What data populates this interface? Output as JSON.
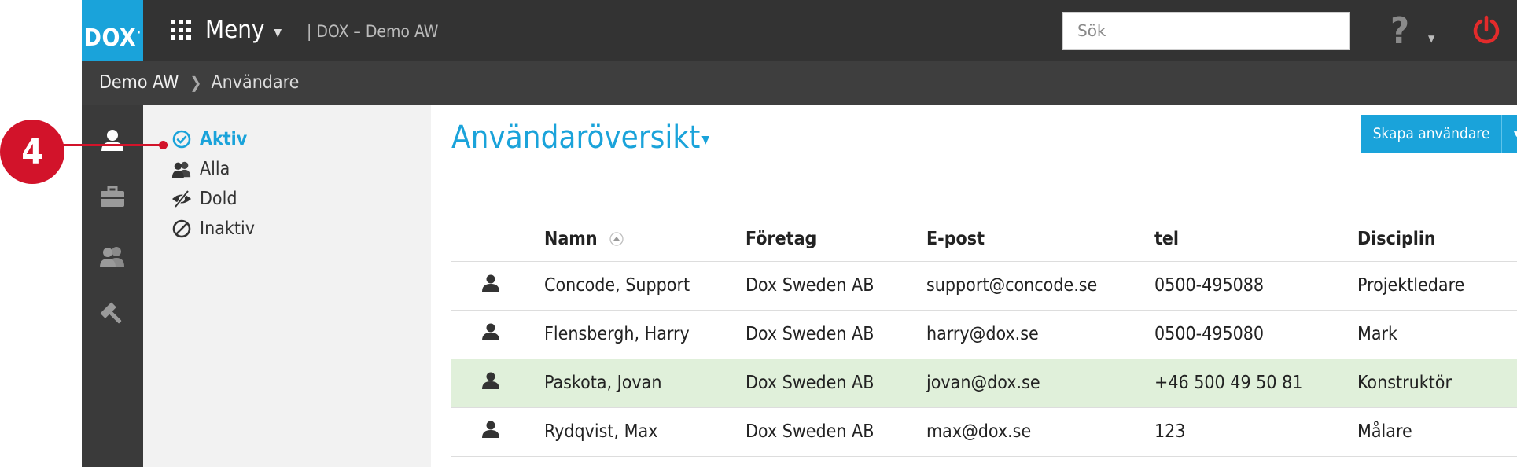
{
  "callout": {
    "number": "4"
  },
  "topbar": {
    "logo": "DOX",
    "menu_label": "Meny",
    "app_path": "| DOX – Demo AW",
    "search_placeholder": "Sök",
    "help_label": "?"
  },
  "breadcrumb": {
    "root": "Demo AW",
    "current": "Användare"
  },
  "rail": {
    "items": [
      {
        "name": "user",
        "icon": "user-icon",
        "active": true
      },
      {
        "name": "company",
        "icon": "briefcase-icon",
        "active": false
      },
      {
        "name": "groups",
        "icon": "users-icon",
        "active": false
      },
      {
        "name": "admin",
        "icon": "hammer-icon",
        "active": false
      }
    ]
  },
  "filters": {
    "items": [
      {
        "label": "Aktiv",
        "icon": "check-circle-icon",
        "active": true
      },
      {
        "label": "Alla",
        "icon": "users-icon",
        "active": false
      },
      {
        "label": "Dold",
        "icon": "eye-slash-icon",
        "active": false
      },
      {
        "label": "Inaktiv",
        "icon": "ban-icon",
        "active": false
      }
    ]
  },
  "main": {
    "title": "Användaröversikt",
    "create_button": "Skapa användare",
    "table": {
      "headers": {
        "name": "Namn",
        "company": "Företag",
        "email": "E-post",
        "tel": "tel",
        "discipline": "Disciplin"
      },
      "rows": [
        {
          "name": "Concode, Support",
          "company": "Dox Sweden AB",
          "email": "support@concode.se",
          "tel": "0500-495088",
          "discipline": "Projektledare",
          "selected": false
        },
        {
          "name": "Flensbergh, Harry",
          "company": "Dox Sweden AB",
          "email": "harry@dox.se",
          "tel": "0500-495080",
          "discipline": "Mark",
          "selected": false
        },
        {
          "name": "Paskota, Jovan",
          "company": "Dox Sweden AB",
          "email": "jovan@dox.se",
          "tel": "+46 500 49 50 81",
          "discipline": "Konstruktör",
          "selected": true
        },
        {
          "name": "Rydqvist, Max",
          "company": "Dox Sweden AB",
          "email": "max@dox.se",
          "tel": "123",
          "discipline": "Målare",
          "selected": false
        }
      ]
    }
  },
  "colors": {
    "accent": "#1aa3da",
    "callout": "#d2132a",
    "power": "#e32b2b",
    "selected_row": "#e0f0da",
    "topbar": "#333333"
  }
}
